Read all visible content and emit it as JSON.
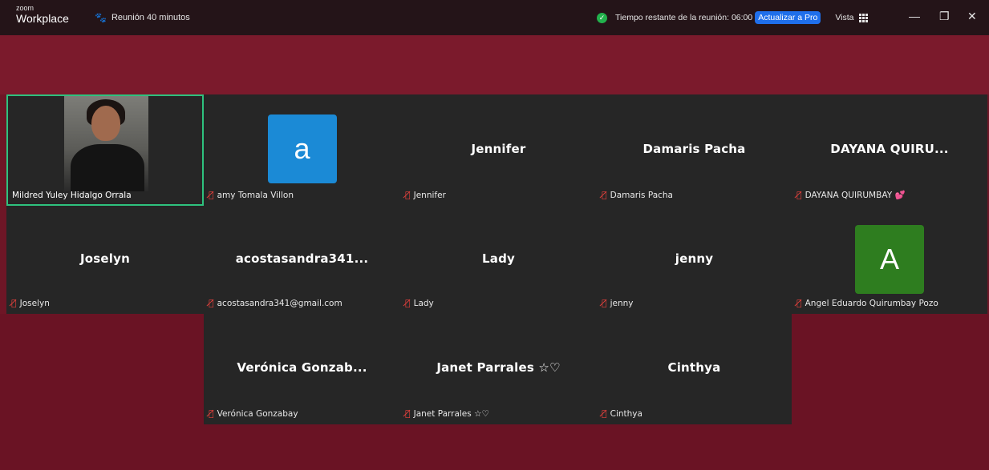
{
  "app": {
    "brand_top": "zoom",
    "brand_bottom": "Workplace"
  },
  "meeting": {
    "title": "Reunión 40 minutos"
  },
  "status": {
    "time_remaining": "Tiempo restante de la reunión: 06:00",
    "upgrade_label": "Actualizar a Pro",
    "view_label": "Vista"
  },
  "window_controls": {
    "minimize": "—",
    "restore": "❐",
    "close": "✕"
  },
  "participants": [
    {
      "display": "",
      "label": "Mildred Yuley Hidalgo Orrala",
      "video": true,
      "muted": false
    },
    {
      "display": "a",
      "label": "amy Tomala Villon",
      "avatar_color": "#1b8ad6",
      "muted": true
    },
    {
      "display": "Jennifer",
      "label": "Jennifer",
      "muted": true
    },
    {
      "display": "Damaris Pacha",
      "label": "Damaris Pacha",
      "muted": true
    },
    {
      "display": "DAYANA  QUIRU...",
      "label": "DAYANA QUIRUMBAY 💕",
      "muted": true
    },
    {
      "display": "Joselyn",
      "label": "Joselyn",
      "muted": true
    },
    {
      "display": "acostasandra341...",
      "label": "acostasandra341@gmail.com",
      "muted": true
    },
    {
      "display": "Lady",
      "label": "Lady",
      "muted": true
    },
    {
      "display": "jenny",
      "label": "jenny",
      "muted": true
    },
    {
      "display": "A",
      "label": "Angel Eduardo Quirumbay Pozo",
      "avatar_color": "#2e7d1f",
      "muted": true
    },
    {
      "display": "Verónica  Gonzab...",
      "label": "Verónica Gonzabay",
      "muted": true
    },
    {
      "display": "Janet Parrales ☆♡",
      "label": "Janet Parrales ☆♡",
      "muted": true
    },
    {
      "display": "Cinthya",
      "label": "Cinthya",
      "muted": true
    }
  ],
  "icons": {
    "mic_muted": "mic-muted-icon",
    "shield": "shield-check-icon",
    "grid": "grid-icon",
    "paw": "paw-icon"
  }
}
